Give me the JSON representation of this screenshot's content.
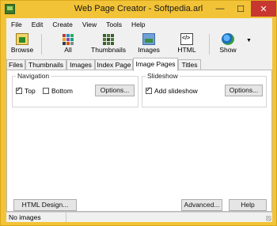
{
  "window": {
    "title": "Web Page Creator - Softpedia.arl",
    "min_glyph": "—",
    "max_glyph": "☐",
    "close_glyph": "✕"
  },
  "menu": [
    "File",
    "Edit",
    "Create",
    "View",
    "Tools",
    "Help"
  ],
  "toolbar": {
    "browse": {
      "label": "Browse",
      "icon": "folder-image-icon"
    },
    "all": {
      "label": "All",
      "icon": "grid-icon"
    },
    "thumbnails": {
      "label": "Thumbnails",
      "icon": "thumbnails-icon"
    },
    "images": {
      "label": "Images",
      "icon": "image-icon"
    },
    "html": {
      "label": "HTML",
      "icon": "html-icon"
    },
    "show": {
      "label": "Show",
      "icon": "globe-icon"
    },
    "dropdown_glyph": "▼"
  },
  "tabs": [
    {
      "label": "Files"
    },
    {
      "label": "Thumbnails"
    },
    {
      "label": "Images"
    },
    {
      "label": "Index Page"
    },
    {
      "label": "Image Pages",
      "active": true
    },
    {
      "label": "Titles"
    }
  ],
  "panel": {
    "navigation": {
      "label": "Navigation",
      "top_label": "Top",
      "top_checked": true,
      "bottom_label": "Bottom",
      "bottom_checked": false,
      "options_label": "Options..."
    },
    "slideshow": {
      "label": "Slideshow",
      "add_label": "Add slideshow",
      "add_checked": true,
      "options_label": "Options..."
    },
    "html_design_label": "HTML Design...",
    "advanced_label": "Advanced...",
    "help_label": "Help"
  },
  "status": {
    "text": "No images"
  },
  "colors": {
    "title_bar": "#f3c337",
    "close_button": "#c7372f"
  }
}
